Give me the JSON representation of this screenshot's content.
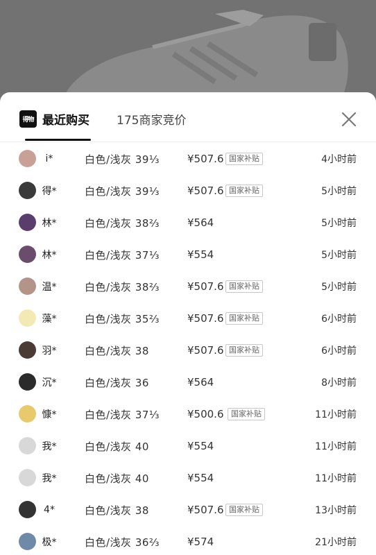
{
  "header": {
    "logo_text": "得物",
    "tab_recent": "最近购买",
    "tab_bids": "175商家竞价"
  },
  "colors": {
    "accent": "#111111",
    "overlay": "#727272",
    "badge_border": "#c8c8c8"
  },
  "purchases": [
    {
      "name": "i*",
      "variant": "白色/浅灰 39⅓",
      "price": "¥507.6",
      "badge": "国家补贴",
      "time": "4小时前",
      "avatar_color": "#c9a095"
    },
    {
      "name": "得*",
      "variant": "白色/浅灰 39⅓",
      "price": "¥507.6",
      "badge": "国家补贴",
      "time": "5小时前",
      "avatar_color": "#3a3a3a"
    },
    {
      "name": "林*",
      "variant": "白色/浅灰 38⅔",
      "price": "¥564",
      "badge": "",
      "time": "5小时前",
      "avatar_color": "#5b3d6b"
    },
    {
      "name": "林*",
      "variant": "白色/浅灰 37⅓",
      "price": "¥554",
      "badge": "",
      "time": "5小时前",
      "avatar_color": "#6a4d6d"
    },
    {
      "name": "温*",
      "variant": "白色/浅灰 38⅔",
      "price": "¥507.6",
      "badge": "国家补贴",
      "time": "5小时前",
      "avatar_color": "#b49489"
    },
    {
      "name": "藻*",
      "variant": "白色/浅灰 35⅔",
      "price": "¥507.6",
      "badge": "国家补贴",
      "time": "6小时前",
      "avatar_color": "#f3e9b5"
    },
    {
      "name": "羽*",
      "variant": "白色/浅灰 38",
      "price": "¥507.6",
      "badge": "国家补贴",
      "time": "6小时前",
      "avatar_color": "#4a3b34"
    },
    {
      "name": "沉*",
      "variant": "白色/浅灰 36",
      "price": "¥564",
      "badge": "",
      "time": "8小时前",
      "avatar_color": "#2b2b2b"
    },
    {
      "name": "慷*",
      "variant": "白色/浅灰 37⅓",
      "price": "¥500.6",
      "badge": "国家补贴",
      "time": "11小时前",
      "avatar_color": "#e8c96b"
    },
    {
      "name": "我*",
      "variant": "白色/浅灰 40",
      "price": "¥554",
      "badge": "",
      "time": "11小时前",
      "avatar_color": "#d8d8d8"
    },
    {
      "name": "我*",
      "variant": "白色/浅灰 40",
      "price": "¥554",
      "badge": "",
      "time": "11小时前",
      "avatar_color": "#d8d8d8"
    },
    {
      "name": "4*",
      "variant": "白色/浅灰 38",
      "price": "¥507.6",
      "badge": "国家补贴",
      "time": "13小时前",
      "avatar_color": "#333333"
    },
    {
      "name": "极*",
      "variant": "白色/浅灰 36⅔",
      "price": "¥574",
      "badge": "",
      "time": "21小时前",
      "avatar_color": "#6f8aa8"
    }
  ]
}
